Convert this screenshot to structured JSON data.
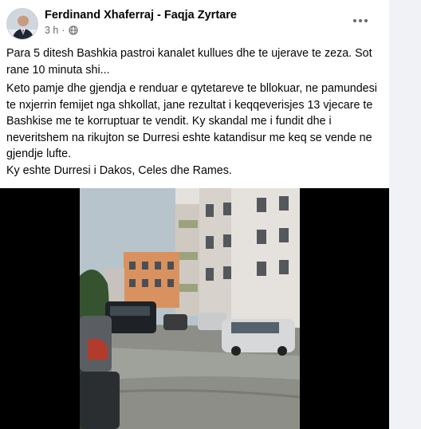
{
  "post": {
    "author": "Ferdinand Xhaferraj - Faqja Zyrtare",
    "time": "3 h",
    "separator": "·",
    "paragraph_1": "Para 5 ditesh Bashkia pastroi kanalet kullues dhe te ujerave te zeza. Sot rane 10 minuta shi...",
    "paragraph_2": "Keto pamje dhe gjendja e renduar e qytetareve te bllokuar, ne pamundesi te nxjerrin femijet nga shkollat, jane rezultat i keqqeverisjes 13 vjecare te Bashkise me te korruptuar te vendit. Ky skandal me i fundit dhe i neveritshem na rikujton se Durresi eshte katandisur me keq se vende ne gjendje lufte.",
    "paragraph_3": "Ky eshte Durresi i Dakos, Celes dhe Rames."
  },
  "icons": {
    "privacy": "globe-icon",
    "menu": "more-options-icon"
  },
  "colors": {
    "card": "#ffffff",
    "background": "#f0f2f5",
    "text": "#050505",
    "secondary_text": "#65676b",
    "video_background": "#000000"
  }
}
